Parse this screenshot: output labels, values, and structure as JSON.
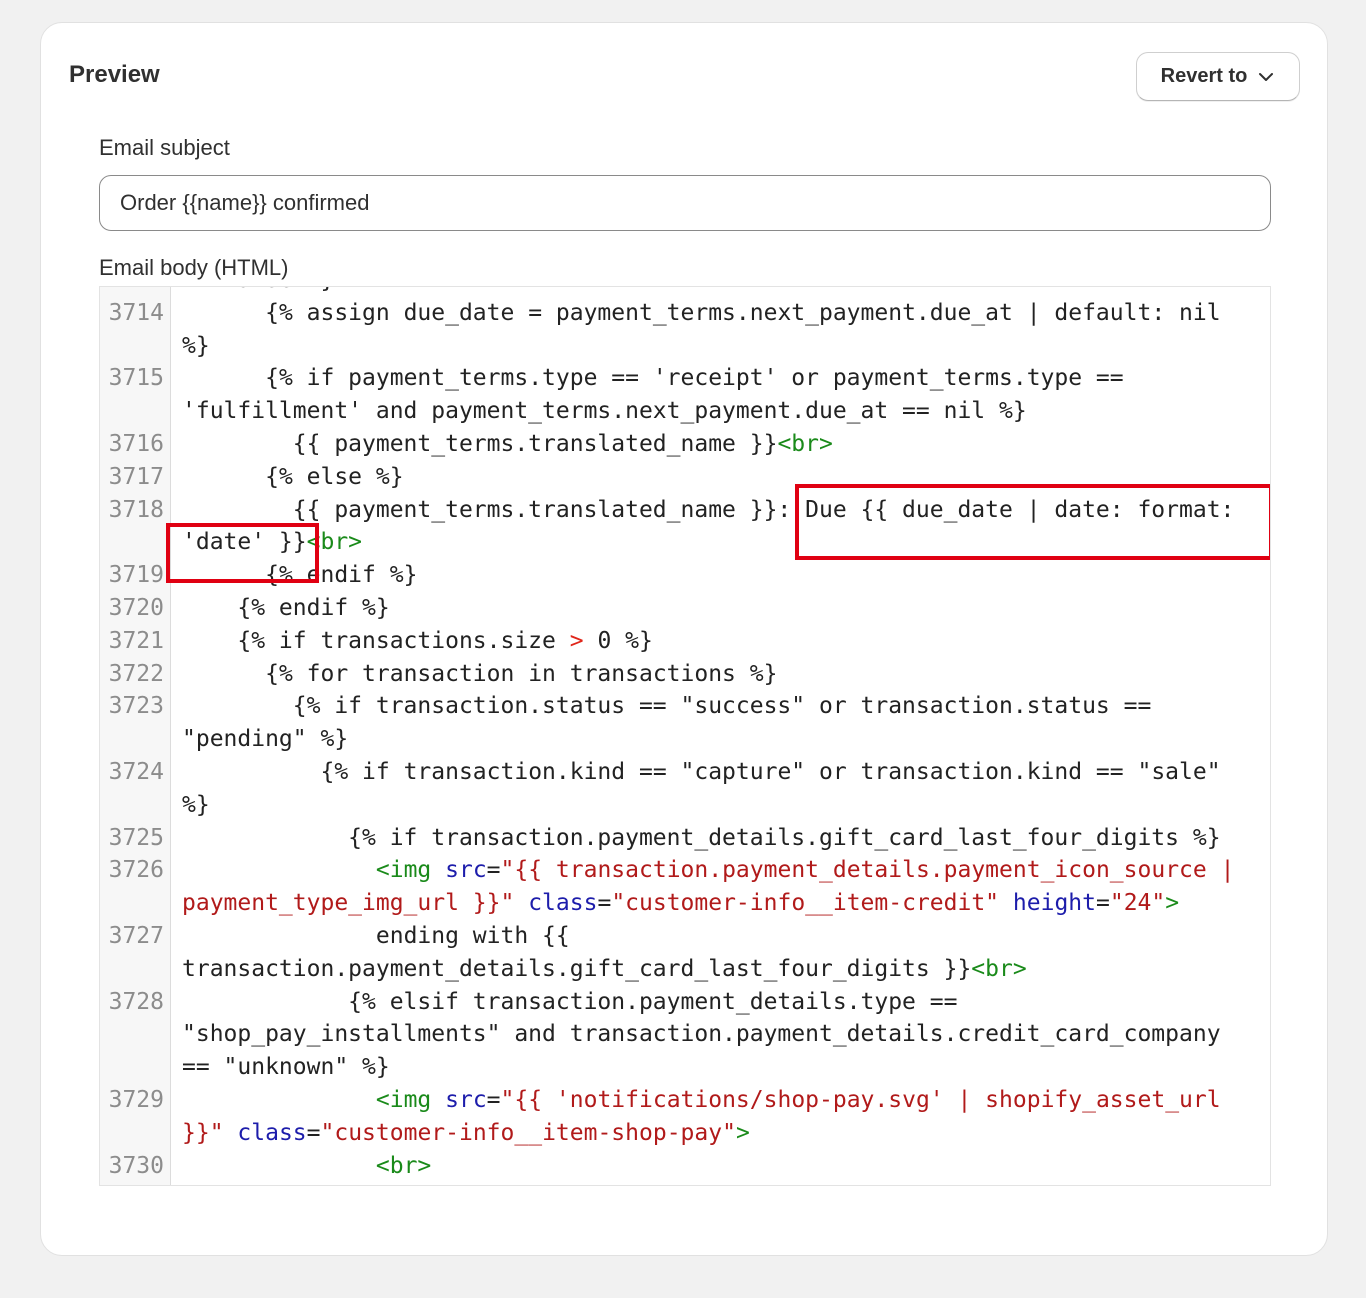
{
  "card": {
    "title": "Preview",
    "revert_label": "Revert to"
  },
  "subject": {
    "label": "Email subject",
    "value": "Order {{name}} confirmed"
  },
  "body": {
    "label": "Email body (HTML)"
  },
  "highlight": {
    "color": "#e00012"
  },
  "code_lines": [
    {
      "n": "",
      "segs": [
        [
          "p",
          "== false %}"
        ]
      ]
    },
    {
      "n": "3714",
      "segs": [
        [
          "p",
          "      {% assign due_date = payment_terms.next_payment.due_at | default: nil %}"
        ]
      ]
    },
    {
      "n": "3715",
      "segs": [
        [
          "p",
          "      {% if payment_terms.type == 'receipt' or payment_terms.type == 'fulfillment' and payment_terms.next_payment.due_at == nil %}"
        ]
      ]
    },
    {
      "n": "3716",
      "segs": [
        [
          "p",
          "        {{ payment_terms.translated_name }}"
        ],
        [
          "tag",
          "<br>"
        ]
      ]
    },
    {
      "n": "3717",
      "segs": [
        [
          "p",
          "      {% else %}"
        ]
      ]
    },
    {
      "n": "3718",
      "segs": [
        [
          "p",
          "        {{ payment_terms.translated_name }}: Due {{ due_date | date: format: 'date' }}"
        ],
        [
          "tag",
          "<br>"
        ]
      ]
    },
    {
      "n": "3719",
      "segs": [
        [
          "p",
          "      {% endif %}"
        ]
      ]
    },
    {
      "n": "3720",
      "segs": [
        [
          "p",
          "    {% endif %}"
        ]
      ]
    },
    {
      "n": "3721",
      "segs": [
        [
          "p",
          "    {% if transactions.size "
        ],
        [
          "op",
          ">"
        ],
        [
          "p",
          " 0 %}"
        ]
      ]
    },
    {
      "n": "3722",
      "segs": [
        [
          "p",
          "      {% for transaction in transactions %}"
        ]
      ]
    },
    {
      "n": "3723",
      "segs": [
        [
          "p",
          "        {% if transaction.status == \"success\" or transaction.status == \"pending\" %}"
        ]
      ]
    },
    {
      "n": "3724",
      "segs": [
        [
          "p",
          "          {% if transaction.kind == \"capture\" or transaction.kind == \"sale\" %}"
        ]
      ]
    },
    {
      "n": "3725",
      "segs": [
        [
          "p",
          "            {% if transaction.payment_details.gift_card_last_four_digits %}"
        ]
      ]
    },
    {
      "n": "3726",
      "segs": [
        [
          "p",
          "              "
        ],
        [
          "tag",
          "<img "
        ],
        [
          "attr",
          "src"
        ],
        [
          "p",
          "="
        ],
        [
          "str",
          "\"{{ transaction.payment_details.payment_icon_source | payment_type_img_url }}\""
        ],
        [
          "p",
          " "
        ],
        [
          "attr",
          "class"
        ],
        [
          "p",
          "="
        ],
        [
          "str",
          "\"customer-info__item-credit\""
        ],
        [
          "p",
          " "
        ],
        [
          "attr",
          "height"
        ],
        [
          "p",
          "="
        ],
        [
          "str",
          "\"24\""
        ],
        [
          "tag",
          ">"
        ]
      ]
    },
    {
      "n": "3727",
      "segs": [
        [
          "p",
          "              ending with {{ transaction.payment_details.gift_card_last_four_digits }}"
        ],
        [
          "tag",
          "<br>"
        ]
      ]
    },
    {
      "n": "3728",
      "segs": [
        [
          "p",
          "            {% elsif transaction.payment_details.type == \"shop_pay_installments\" and transaction.payment_details.credit_card_company == \"unknown\" %}"
        ]
      ]
    },
    {
      "n": "3729",
      "segs": [
        [
          "p",
          "              "
        ],
        [
          "tag",
          "<img "
        ],
        [
          "attr",
          "src"
        ],
        [
          "p",
          "="
        ],
        [
          "str",
          "\"{{ 'notifications/shop-pay.svg' | shopify_asset_url }}\""
        ],
        [
          "p",
          " "
        ],
        [
          "attr",
          "class"
        ],
        [
          "p",
          "="
        ],
        [
          "str",
          "\"customer-info__item-shop-pay\""
        ],
        [
          "tag",
          ">"
        ]
      ]
    },
    {
      "n": "3730",
      "segs": [
        [
          "p",
          "              "
        ],
        [
          "tag",
          "<br>"
        ]
      ]
    }
  ]
}
